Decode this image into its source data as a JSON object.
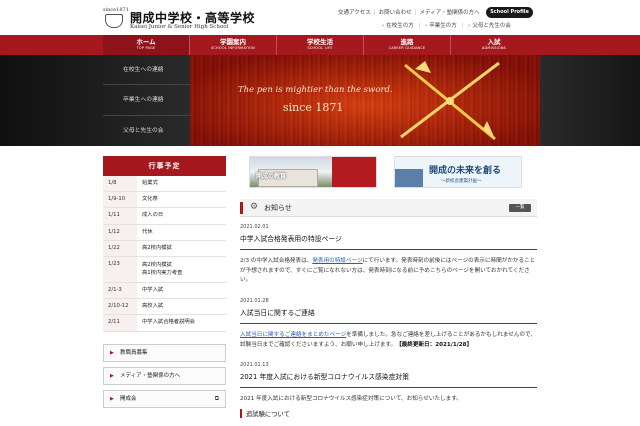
{
  "header": {
    "since": "since1871",
    "school_name_jp": "開成中学校・高等学校",
    "school_name_en": "Kaisei Junior & Senior High School",
    "util_top": [
      "交通アクセス",
      "お問い合わせ",
      "メディア・塾関係の方へ"
    ],
    "util_bottom": [
      "在校生の方",
      "卒業生の方",
      "父母と先生の会"
    ],
    "profile_button": "School Profile"
  },
  "nav": [
    {
      "jp": "ホーム",
      "en": "TOP PAGE"
    },
    {
      "jp": "学園案内",
      "en": "SCHOOL INFORMATION"
    },
    {
      "jp": "学校生活",
      "en": "SCHOOL LIFE"
    },
    {
      "jp": "進路",
      "en": "CAREER GUIDANCE"
    },
    {
      "jp": "入試",
      "en": "ADMISSIONS"
    }
  ],
  "hero": {
    "tagline": "The pen is mightier than the sword.",
    "since": "since 1871",
    "side_links": [
      "在校生への連絡",
      "卒業生への連絡",
      "父母と先生の会"
    ]
  },
  "events": {
    "heading": "行事予定",
    "rows": [
      {
        "date": "1/8",
        "title": "始業式"
      },
      {
        "date": "1/9-10",
        "title": "文化祭"
      },
      {
        "date": "1/11",
        "title": "成人の日"
      },
      {
        "date": "1/12",
        "title": "代休"
      },
      {
        "date": "1/22",
        "title": "高2校内模試"
      },
      {
        "date": "1/23",
        "title": "高2校内模試\n高1校内実力考査"
      },
      {
        "date": "2/1-3",
        "title": "中学入試"
      },
      {
        "date": "2/10-12",
        "title": "高校入試"
      },
      {
        "date": "2/11",
        "title": "中学入試合格者説明会"
      }
    ]
  },
  "side_boxes": [
    "教職員募集",
    "メディア・塾関係の方へ",
    "開成会"
  ],
  "banners": {
    "b1": "開成の教育",
    "b2_title": "開成の未来を創る",
    "b2_sub": "～新校舎建築計画～"
  },
  "news": {
    "heading": "お知らせ",
    "all_button": "一覧",
    "items": [
      {
        "date": "2021.02.01",
        "title": "中学入試合格発表用の特設ページ",
        "body_pre": "2/3 の中学入試合格発表は、",
        "body_link": "発表用の特設ページ",
        "body_post": "にて行います。発表時刻の前後にはページの表示に時間がかかることが予想されますので、すぐにご覧になれない方は、発表時刻になる前に予めこちらのページを開いておかれてください。"
      },
      {
        "date": "2021.01.28",
        "title": "入試当日に関するご連絡",
        "body_link": "入試当日に関するご連絡をまとめたページ",
        "body_post": "を準備しました。急なご連絡を差し上げることがあるかもしれませんので、試験当日までご確認くださいますよう、お願い申し上げます。",
        "body_bold": "【最終更新日：2021/1/28】"
      },
      {
        "date": "2021.01.13",
        "title": "2021 年度入試における新型コロナウイルス感染症対策",
        "body": "2021 年度入試における新型コロナウイルス感染症対策について、お知らせいたします。"
      }
    ],
    "sub_heading": "追試験について"
  }
}
